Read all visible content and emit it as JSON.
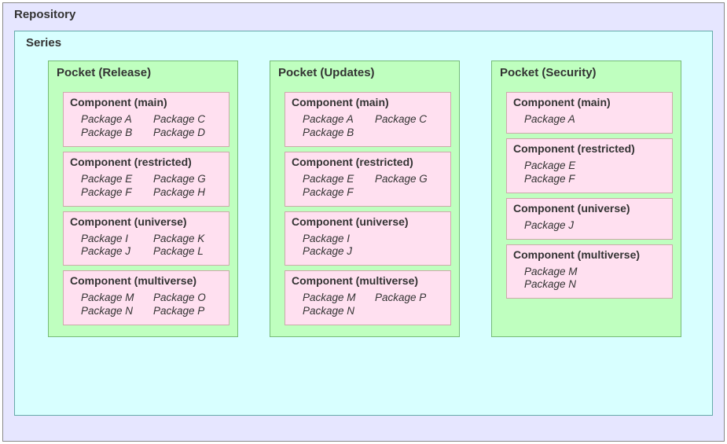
{
  "repository": {
    "title": "Repository",
    "series": {
      "title": "Series",
      "pockets": [
        {
          "title": "Pocket (Release)",
          "components": [
            {
              "title": "Component (main)",
              "packages": [
                "Package A",
                "Package C",
                "Package B",
                "Package D"
              ],
              "cols": 2
            },
            {
              "title": "Component (restricted)",
              "packages": [
                "Package E",
                "Package G",
                "Package F",
                "Package H"
              ],
              "cols": 2
            },
            {
              "title": "Component (universe)",
              "packages": [
                "Package I",
                "Package K",
                "Package J",
                "Package L"
              ],
              "cols": 2
            },
            {
              "title": "Component (multiverse)",
              "packages": [
                "Package M",
                "Package O",
                "Package N",
                "Package P"
              ],
              "cols": 2
            }
          ]
        },
        {
          "title": "Pocket (Updates)",
          "components": [
            {
              "title": "Component (main)",
              "packages": [
                "Package A",
                "Package C",
                "Package B"
              ],
              "cols": 2
            },
            {
              "title": "Component (restricted)",
              "packages": [
                "Package E",
                "Package G",
                "Package F"
              ],
              "cols": 2
            },
            {
              "title": "Component (universe)",
              "packages": [
                "Package I",
                "Package J"
              ],
              "cols": 1
            },
            {
              "title": "Component (multiverse)",
              "packages": [
                "Package M",
                "Package P",
                "Package N"
              ],
              "cols": 2
            }
          ]
        },
        {
          "title": "Pocket (Security)",
          "components": [
            {
              "title": "Component (main)",
              "packages": [
                "Package A"
              ],
              "cols": 1
            },
            {
              "title": "Component (restricted)",
              "packages": [
                "Package E",
                "Package F"
              ],
              "cols": 1
            },
            {
              "title": "Component (universe)",
              "packages": [
                "Package J"
              ],
              "cols": 1
            },
            {
              "title": "Component (multiverse)",
              "packages": [
                "Package M",
                "Package N"
              ],
              "cols": 1
            }
          ]
        }
      ]
    }
  }
}
